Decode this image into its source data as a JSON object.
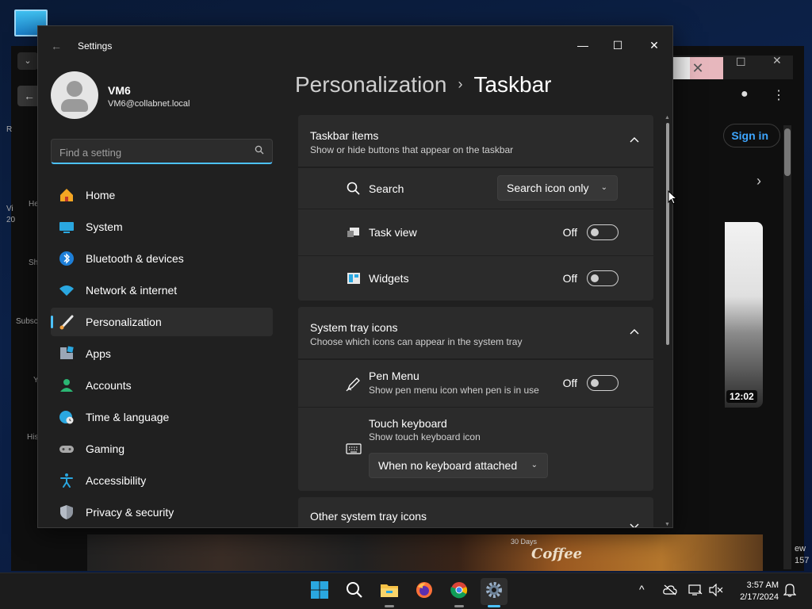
{
  "window": {
    "title": "Settings",
    "controls": {
      "minimize": "—",
      "maximize": "☐",
      "close": "✕"
    }
  },
  "profile": {
    "name": "VM6",
    "email": "VM6@collabnet.local"
  },
  "search": {
    "placeholder": "Find a setting"
  },
  "nav": [
    {
      "label": "Home",
      "icon": "home-icon",
      "active": false
    },
    {
      "label": "System",
      "icon": "display-icon",
      "active": false
    },
    {
      "label": "Bluetooth & devices",
      "icon": "bluetooth-icon",
      "active": false
    },
    {
      "label": "Network & internet",
      "icon": "wifi-icon",
      "active": false
    },
    {
      "label": "Personalization",
      "icon": "paintbrush-icon",
      "active": true
    },
    {
      "label": "Apps",
      "icon": "apps-icon",
      "active": false
    },
    {
      "label": "Accounts",
      "icon": "person-icon",
      "active": false
    },
    {
      "label": "Time & language",
      "icon": "globe-clock-icon",
      "active": false
    },
    {
      "label": "Gaming",
      "icon": "gamepad-icon",
      "active": false
    },
    {
      "label": "Accessibility",
      "icon": "accessibility-icon",
      "active": false
    },
    {
      "label": "Privacy & security",
      "icon": "shield-icon",
      "active": false
    }
  ],
  "breadcrumb": {
    "parent": "Personalization",
    "separator": "›",
    "current": "Taskbar"
  },
  "taskbar_items": {
    "title": "Taskbar items",
    "subtitle": "Show or hide buttons that appear on the taskbar",
    "rows": {
      "search": {
        "label": "Search",
        "value": "Search icon only"
      },
      "task_view": {
        "label": "Task view",
        "state": "Off"
      },
      "widgets": {
        "label": "Widgets",
        "state": "Off"
      }
    }
  },
  "system_tray": {
    "title": "System tray icons",
    "subtitle": "Choose which icons can appear in the system tray",
    "rows": {
      "pen_menu": {
        "label": "Pen Menu",
        "sub": "Show pen menu icon when pen is in use",
        "state": "Off"
      },
      "touch_keyboard": {
        "label": "Touch keyboard",
        "sub": "Show touch keyboard icon",
        "value": "When no keyboard attached"
      }
    }
  },
  "other_tray": {
    "title": "Other system tray icons"
  },
  "background_app": {
    "sign_in": "Sign in",
    "video_duration": "12:02",
    "banner_days": "30 Days",
    "banner_text": "Coffee"
  },
  "clock": {
    "time": "3:57 AM",
    "date": "2/17/2024"
  },
  "colors": {
    "accent": "#4cc2ff",
    "window_bg": "#202020",
    "card_bg": "#2b2b2b"
  }
}
